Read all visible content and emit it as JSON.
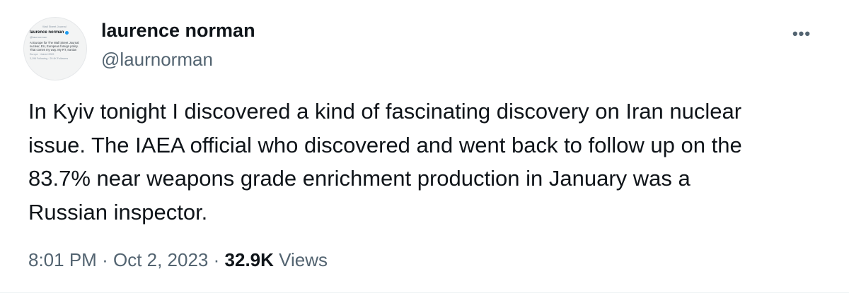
{
  "author": {
    "display_name": "laurence norman",
    "handle": "@laurnorman",
    "avatar": {
      "top_line": "Wall Street Journal",
      "name": "laurence norman",
      "handle": "@laurnorman",
      "bio": "At Europe for The Wall Street Journal nuclear, EU, European foreign policy. That comes my way. My RT, Iranian",
      "meta": "Europe · Joined 2009",
      "counts": "3,196 Following · 29.4K Followers"
    }
  },
  "menu": {
    "more_icon": "more-horizontal-icon",
    "more_label": "•••"
  },
  "tweet": {
    "text": "In Kyiv tonight I discovered a kind of fascinating discovery on Iran nuclear\nissue. The IAEA official who discovered and went back to follow up on the\n83.7% near weapons grade enrichment production in January was a\nRussian inspector."
  },
  "meta": {
    "time": "8:01 PM",
    "separator": "·",
    "date": "Oct 2, 2023",
    "views_count": "32.9K",
    "views_label": "Views"
  },
  "colors": {
    "text_primary": "#0f1419",
    "text_secondary": "#536471",
    "verified": "#1d9bf0"
  }
}
